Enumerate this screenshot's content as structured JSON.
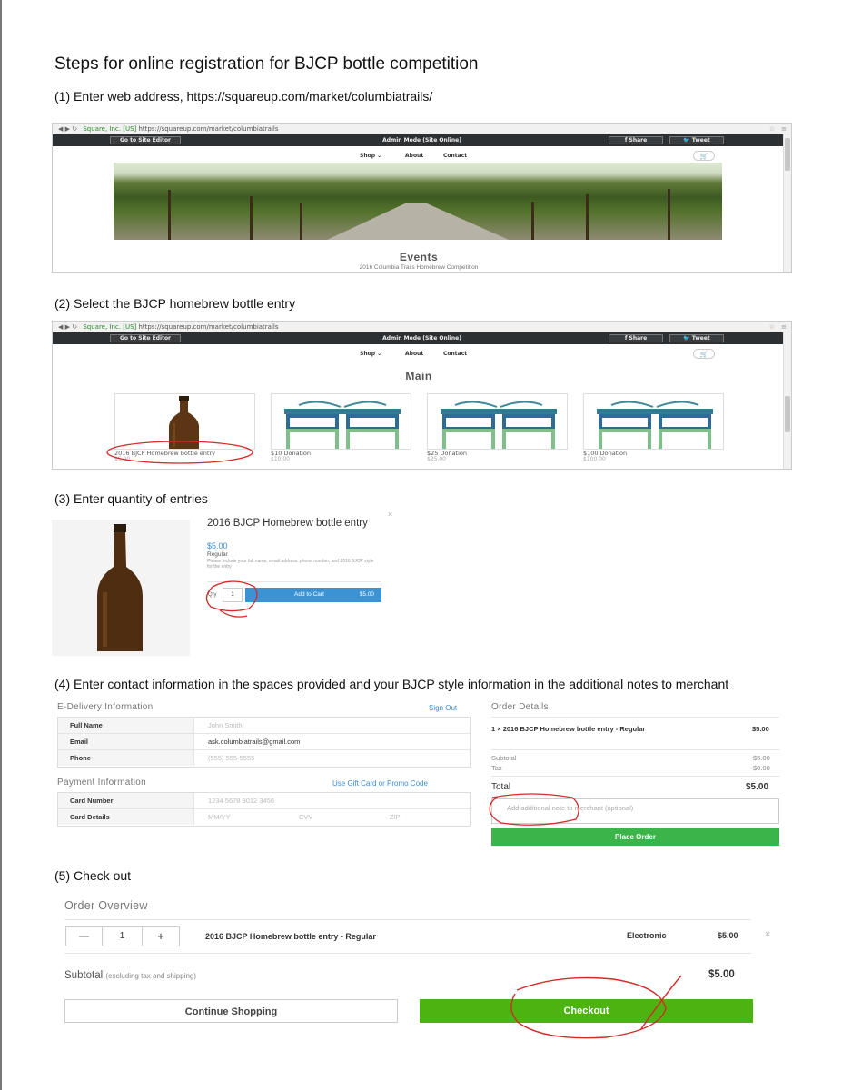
{
  "title": "Steps for online registration for BJCP bottle competition",
  "steps": {
    "s1": "(1) Enter web address, https://squareup.com/market/columbiatrails/",
    "s2": "(2) Select the BJCP homebrew bottle entry",
    "s3": "(3) Enter quantity of entries",
    "s4": "(4) Enter contact information in the spaces provided and your BJCP style information in the additional notes to merchant",
    "s5": "(5) Check out"
  },
  "browser": {
    "url_secure_label": "Square, Inc. [US]",
    "url": "https://squareup.com/market/columbiatrails",
    "go_to_editor": "Go to Site Editor",
    "admin_mode": "Admin Mode (Site Online)",
    "share": "Share",
    "tweet": "Tweet",
    "nav": [
      "Shop ⌄",
      "About",
      "Contact"
    ]
  },
  "shot1": {
    "events_heading": "Events",
    "events_sub": "2016 Columbia Trails Homebrew Competition"
  },
  "shot2": {
    "heading": "Main",
    "products": [
      {
        "name": "2016 BJCP Homebrew bottle entry",
        "price": "$5.00"
      },
      {
        "name": "$10 Donation",
        "price": "$10.00"
      },
      {
        "name": "$25 Donation",
        "price": "$25.00"
      },
      {
        "name": "$100 Donation",
        "price": "$100.00"
      }
    ]
  },
  "modal": {
    "title": "2016 BJCP Homebrew bottle entry",
    "price": "$5.00",
    "variant": "Regular",
    "note": "Please include your full name, email address, phone number, and 2016 BJCP style for the entry",
    "qty_label": "Qty",
    "qty_value": "1",
    "add_to_cart": "Add to Cart",
    "add_to_cart_amount": "$5.00",
    "close": "×"
  },
  "checkout_form": {
    "delivery_heading": "E-Delivery Information",
    "sign_out": "Sign Out",
    "fields": [
      {
        "label": "Full Name",
        "value": "John Smith"
      },
      {
        "label": "Email",
        "value": "ask.columbiatrails@gmail.com"
      },
      {
        "label": "Phone",
        "value": "(555) 555-5555"
      }
    ],
    "payment_heading": "Payment Information",
    "gift_card": "Use Gift Card or Promo Code",
    "card_number_label": "Card Number",
    "card_number_placeholder": "1234 5678 9012 3456",
    "card_details_label": "Card Details",
    "mm_yy": "MM/YY",
    "cvv": "CVV",
    "zip": "ZIP"
  },
  "order_details": {
    "heading": "Order Details",
    "line_item": "1 × 2016 BJCP Homebrew bottle entry - Regular",
    "line_amount": "$5.00",
    "subtotal_label": "Subtotal",
    "subtotal": "$5.00",
    "tax_label": "Tax",
    "tax": "$0.00",
    "total_label": "Total",
    "total": "$5.00",
    "notes_placeholder": "Add additional note to merchant (optional)",
    "place_order": "Place Order"
  },
  "overview": {
    "heading": "Order Overview",
    "minus": "—",
    "qty": "1",
    "plus": "+",
    "item": "2016 BJCP Homebrew bottle entry - Regular",
    "type": "Electronic",
    "price": "$5.00",
    "remove": "×",
    "subtotal_label": "Subtotal",
    "subtotal_note": "(excluding tax and shipping)",
    "subtotal": "$5.00",
    "continue": "Continue Shopping",
    "checkout": "Checkout"
  },
  "colors": {
    "admin_bar": "#2d3033",
    "add_to_cart": "#3b93d4",
    "checkout_green": "#4db310",
    "place_order_green": "#3bb54a",
    "annotation_red": "#d42a2a"
  }
}
